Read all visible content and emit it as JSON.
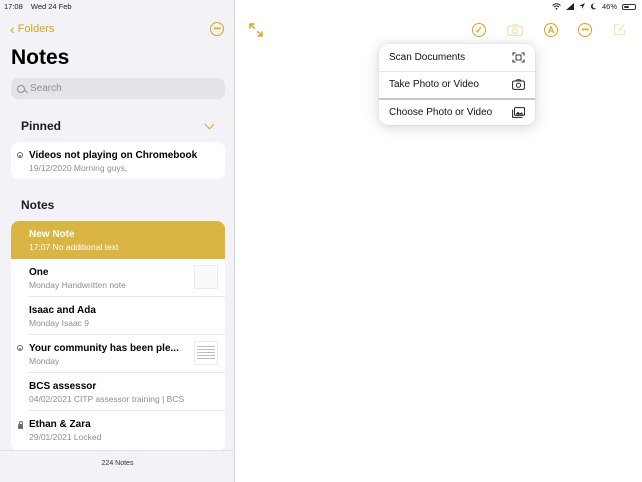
{
  "status_bar": {
    "time": "17:08",
    "date": "Wed 24 Feb",
    "battery": "46%",
    "battery_level": 0.46,
    "icons": [
      "wifi-icon",
      "signal-icon",
      "location-icon",
      "moon-icon",
      "battery-icon"
    ]
  },
  "sidebar": {
    "back_label": "Folders",
    "title": "Notes",
    "search_placeholder": "Search",
    "pinned_header": "Pinned",
    "notes_header": "Notes",
    "pinned": [
      {
        "title": "Videos not playing on Chromebook",
        "subtitle": "19/12/2020  Morning guys,",
        "shared": true
      }
    ],
    "notes": [
      {
        "title": "New Note",
        "subtitle": "17:07  No additional text",
        "selected": true
      },
      {
        "title": "One",
        "subtitle": "Monday  Handwritten note",
        "thumbnail": "blank"
      },
      {
        "title": "Isaac and Ada",
        "subtitle": "Monday  Isaac 9"
      },
      {
        "title": "Your community has been ple...",
        "subtitle": "Monday",
        "shared": true,
        "thumbnail": "document"
      },
      {
        "title": "BCS assessor",
        "subtitle": "04/02/2021  CITP assessor training | BCS"
      },
      {
        "title": "Ethan  & Zara",
        "subtitle": "29/01/2021  Locked",
        "locked": true
      }
    ],
    "notes_count": "224 Notes"
  },
  "toolbar": {
    "icons": [
      "expand-icon",
      "checklist-icon",
      "camera-icon",
      "markup-pen-icon",
      "more-icon",
      "compose-icon"
    ]
  },
  "camera_menu": {
    "items": [
      {
        "label": "Scan Documents",
        "icon": "scan-document-icon"
      },
      {
        "label": "Take Photo or Video",
        "icon": "camera-icon"
      },
      {
        "label": "Choose Photo or Video",
        "icon": "photo-library-icon"
      }
    ]
  },
  "colors": {
    "accent": "#d9a41a",
    "selected_row": "#dbb544",
    "sidebar_bg": "#f2f2f7"
  }
}
